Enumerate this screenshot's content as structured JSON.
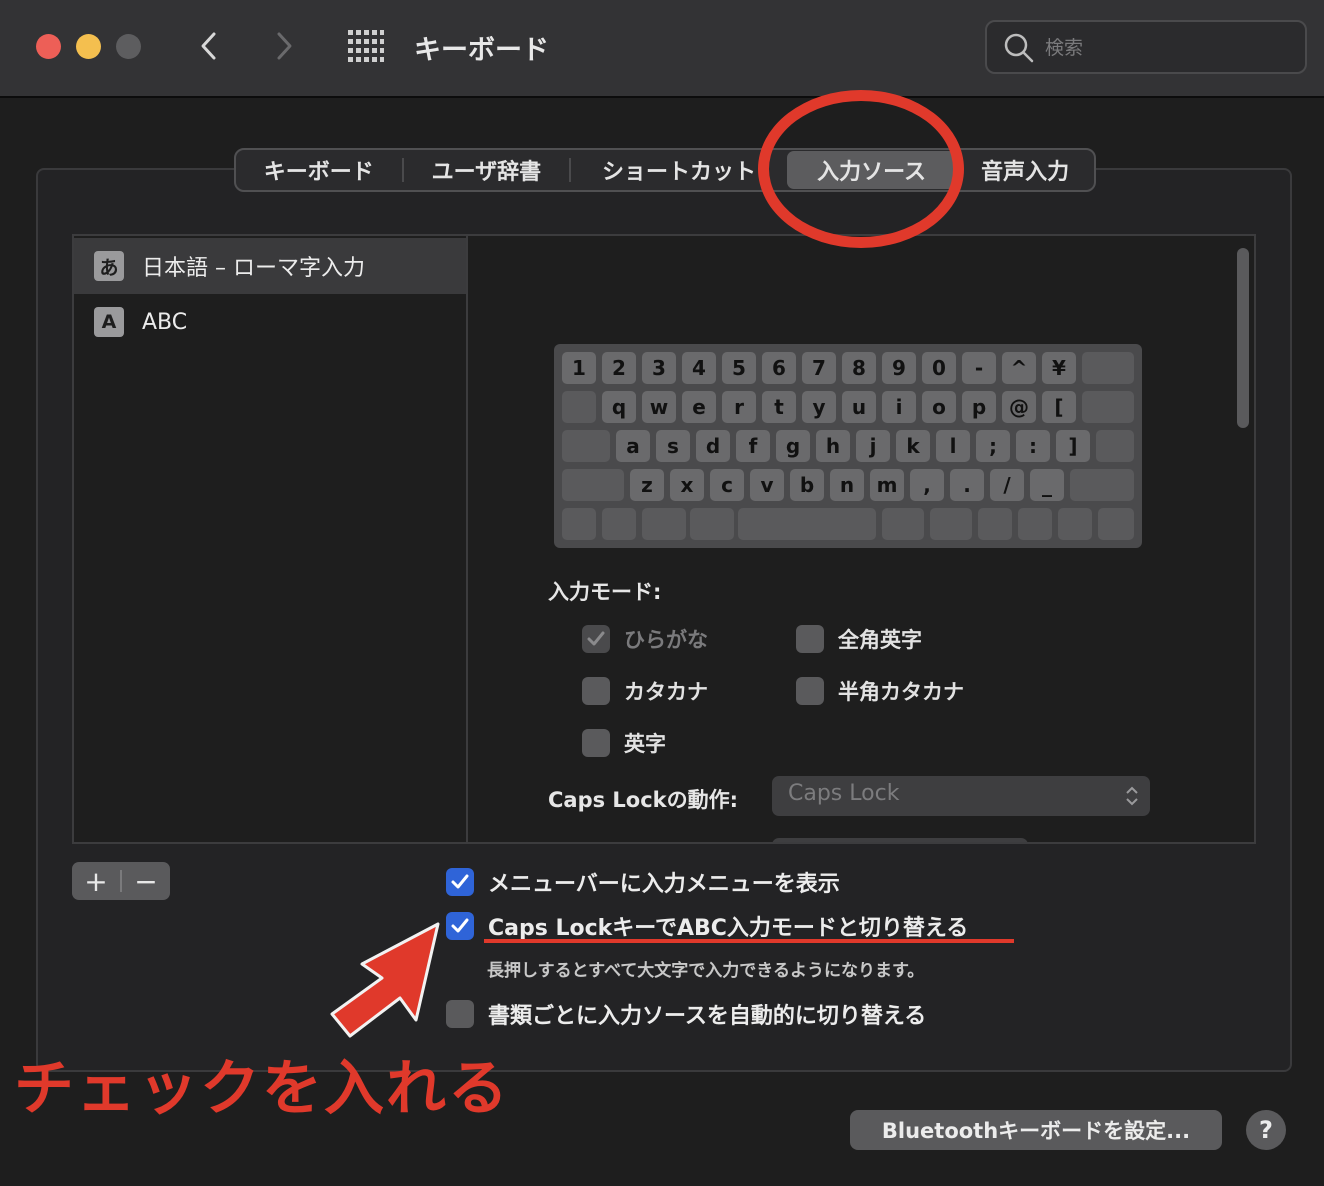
{
  "window": {
    "title": "キーボード",
    "search_placeholder": "検索"
  },
  "tabs": [
    "キーボード",
    "ユーザ辞書",
    "ショートカット",
    "入力ソース",
    "音声入力"
  ],
  "selected_tab": "入力ソース",
  "input_sources": [
    {
      "icon": "あ",
      "label": "日本語 – ローマ字入力",
      "selected": true
    },
    {
      "icon": "A",
      "label": "ABC",
      "selected": false
    }
  ],
  "keyboard": {
    "row1": [
      "1",
      "2",
      "3",
      "4",
      "5",
      "6",
      "7",
      "8",
      "9",
      "0",
      "-",
      "^",
      "¥"
    ],
    "row2": [
      "q",
      "w",
      "e",
      "r",
      "t",
      "y",
      "u",
      "i",
      "o",
      "p",
      "@",
      "["
    ],
    "row3": [
      "a",
      "s",
      "d",
      "f",
      "g",
      "h",
      "j",
      "k",
      "l",
      ";",
      ":",
      "]"
    ],
    "row4": [
      "z",
      "x",
      "c",
      "v",
      "b",
      "n",
      "m",
      ",",
      ".",
      "/",
      "_"
    ]
  },
  "input_mode": {
    "label": "入力モード:",
    "options": {
      "hiragana": {
        "label": "ひらがな",
        "checked": true,
        "disabled": true
      },
      "zenkaku": {
        "label": "全角英字",
        "checked": false
      },
      "katakana": {
        "label": "カタカナ",
        "checked": false
      },
      "hankaku": {
        "label": "半角カタカナ",
        "checked": false
      },
      "eiji": {
        "label": "英字",
        "checked": false
      }
    }
  },
  "caps_lock": {
    "label": "Caps Lockの動作:",
    "value": "Caps Lock"
  },
  "list_buttons": {
    "add": "+",
    "remove": "−"
  },
  "options": {
    "show_menu": {
      "label": "メニューバーに入力メニューを表示",
      "checked": true
    },
    "caps_switch": {
      "label": "Caps LockキーでABC入力モードと切り替える",
      "checked": true,
      "hint": "長押しするとすべて大文字で入力できるようになります。"
    },
    "auto_switch": {
      "label": "書類ごとに入力ソースを自動的に切り替える",
      "checked": false
    }
  },
  "annotation": {
    "callout": "チェックを入れる",
    "color": "#e0392b"
  },
  "bluetooth_button": "Bluetoothキーボードを設定...",
  "help_button": "?"
}
